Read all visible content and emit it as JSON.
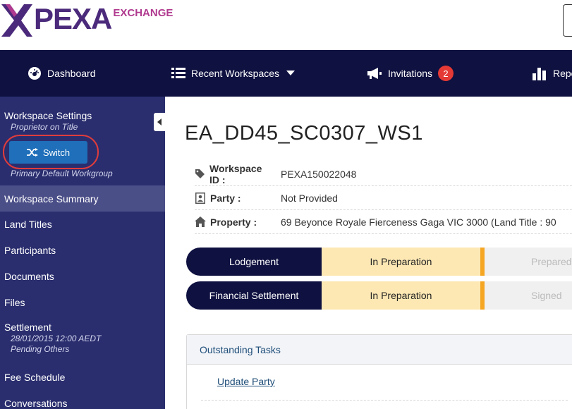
{
  "brand": {
    "name": "PEXA",
    "sub": "EXCHANGE"
  },
  "nav": {
    "dashboard": "Dashboard",
    "recent": "Recent Workspaces",
    "invitations": "Invitations",
    "invitations_count": "2",
    "reports": "Repo"
  },
  "sidebar": {
    "settings_title": "Workspace Settings",
    "role": "Proprietor on Title",
    "switch_label": "Switch",
    "workgroup": "Primary Default Workgroup",
    "items": [
      {
        "label": "Workspace Summary"
      },
      {
        "label": "Land Titles"
      },
      {
        "label": "Participants"
      },
      {
        "label": "Documents"
      },
      {
        "label": "Files"
      },
      {
        "label": "Settlement"
      },
      {
        "label": "Fee Schedule"
      },
      {
        "label": "Conversations"
      }
    ],
    "settlement_date": "28/01/2015 12:00 AEDT",
    "settlement_status": "Pending Others"
  },
  "workspace": {
    "title": "EA_DD45_SC0307_WS1",
    "id_label": "Workspace ID :",
    "id_value": "PEXA150022048",
    "party_label": "Party :",
    "party_value": "Not Provided",
    "property_label": "Property :",
    "property_value": "69 Beyonce Royale Fierceness Gaga VIC 3000 (Land Title : 90"
  },
  "status": [
    {
      "name": "Lodgement",
      "state": "In Preparation",
      "next": "Prepared"
    },
    {
      "name": "Financial Settlement",
      "state": "In Preparation",
      "next": "Signed"
    }
  ],
  "tasks": {
    "header": "Outstanding Tasks",
    "items": [
      {
        "label": "Update Party"
      }
    ]
  },
  "colors": {
    "nav_bg": "#0f1140",
    "sidebar_bg": "#2a2e6e",
    "accent": "#1f6fba",
    "badge": "#e53935",
    "in_prep": "#fde8b4",
    "marker": "#f5a623"
  },
  "icons": {
    "dashboard": "gauge-icon",
    "recent": "list-icon",
    "invitations": "megaphone-icon",
    "reports": "bar-chart-icon",
    "switch": "shuffle-icon",
    "id": "tag-icon",
    "party": "id-card-icon",
    "property": "home-icon"
  }
}
